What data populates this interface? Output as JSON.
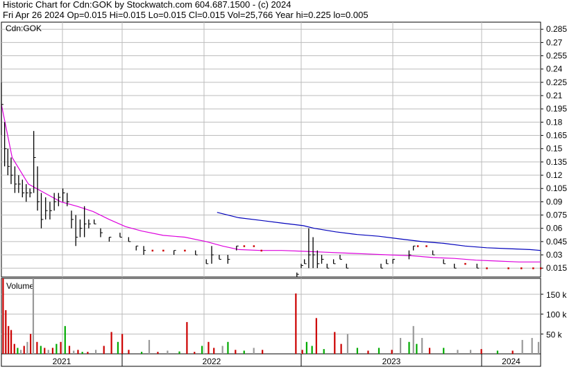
{
  "header": {
    "line1": "Historic Chart for Cdn:GOK by Stockwatch.com 604.687.1500 - (c) 2024",
    "line2": "Fri Apr 26 2024  Op=0.015  Hi=0.015  Lo=0.015  Cl=0.015  Vol=25,766  Year hi=0.225  lo=0.005"
  },
  "chart_data": [
    {
      "type": "ohlc",
      "symbol_label": "Cdn:GOK",
      "ylim": [
        0.005,
        0.293
      ],
      "y_ticks": [
        "0.285",
        "0.27",
        "0.255",
        "0.24",
        "0.225",
        "0.21",
        "0.195",
        "0.18",
        "0.165",
        "0.15",
        "0.135",
        "0.12",
        "0.105",
        "0.09",
        "0.075",
        "0.06",
        "0.045",
        "0.03",
        "0.015"
      ],
      "x_years": [
        "2021",
        "2022",
        "2023",
        "2024"
      ],
      "colors": {
        "up": "#000000",
        "flat": "#cc0000",
        "ma_short": "#dd00dd",
        "ma_long": "#0000bb",
        "grid": "#bbbbbb"
      },
      "price_bars": [
        [
          0.0,
          0.225,
          0.165,
          0.2
        ],
        [
          0.6,
          0.18,
          0.13,
          0.15
        ],
        [
          1.2,
          0.15,
          0.12,
          0.13
        ],
        [
          1.8,
          0.14,
          0.11,
          0.12
        ],
        [
          2.5,
          0.13,
          0.1,
          0.11
        ],
        [
          3.2,
          0.12,
          0.1,
          0.11
        ],
        [
          3.9,
          0.115,
          0.095,
          0.1
        ],
        [
          4.6,
          0.11,
          0.09,
          0.1
        ],
        [
          5.3,
          0.105,
          0.095,
          0.1
        ],
        [
          6.0,
          0.17,
          0.1,
          0.14
        ],
        [
          6.7,
          0.13,
          0.08,
          0.09
        ],
        [
          7.4,
          0.1,
          0.06,
          0.07
        ],
        [
          8.2,
          0.095,
          0.07,
          0.08
        ],
        [
          9.0,
          0.09,
          0.07,
          0.08
        ],
        [
          9.8,
          0.1,
          0.08,
          0.09
        ],
        [
          10.6,
          0.1,
          0.085,
          0.095
        ],
        [
          11.4,
          0.105,
          0.09,
          0.1
        ],
        [
          12.2,
          0.1,
          0.085,
          0.09
        ],
        [
          13.0,
          0.08,
          0.06,
          0.07
        ],
        [
          13.8,
          0.075,
          0.04,
          0.05
        ],
        [
          14.6,
          0.07,
          0.05,
          0.06
        ],
        [
          15.4,
          0.085,
          0.05,
          0.065
        ],
        [
          16.2,
          0.07,
          0.06,
          0.065
        ],
        [
          17.2,
          0.07,
          0.065,
          0.065
        ],
        [
          18.4,
          0.06,
          0.05,
          0.055
        ],
        [
          20.0,
          0.05,
          0.045,
          0.05
        ],
        [
          22.0,
          0.055,
          0.05,
          0.05
        ],
        [
          23.6,
          0.05,
          0.045,
          0.045
        ],
        [
          25.0,
          0.04,
          0.035,
          0.04
        ],
        [
          26.4,
          0.04,
          0.03,
          0.035
        ],
        [
          28.0,
          0.035,
          0.035,
          0.035
        ],
        [
          30.0,
          0.035,
          0.035,
          0.035
        ],
        [
          32.0,
          0.035,
          0.03,
          0.035
        ],
        [
          34.0,
          0.035,
          0.035,
          0.035
        ],
        [
          36.0,
          0.035,
          0.03,
          0.03
        ],
        [
          38.0,
          0.025,
          0.02,
          0.02
        ],
        [
          39.0,
          0.04,
          0.02,
          0.03
        ],
        [
          40.4,
          0.03,
          0.025,
          0.025
        ],
        [
          42.0,
          0.03,
          0.02,
          0.025
        ],
        [
          43.6,
          0.04,
          0.035,
          0.04
        ],
        [
          45.0,
          0.04,
          0.04,
          0.04
        ],
        [
          46.8,
          0.04,
          0.04,
          0.04
        ],
        [
          48.2,
          0.035,
          0.035,
          0.035
        ],
        [
          54.8,
          0.01,
          0.005,
          0.008
        ],
        [
          55.6,
          0.02,
          0.015,
          0.018
        ],
        [
          56.2,
          0.025,
          0.02,
          0.02
        ],
        [
          57.0,
          0.06,
          0.015,
          0.03
        ],
        [
          57.8,
          0.05,
          0.015,
          0.03
        ],
        [
          58.6,
          0.035,
          0.015,
          0.02
        ],
        [
          59.4,
          0.03,
          0.02,
          0.025
        ],
        [
          60.4,
          0.02,
          0.015,
          0.015
        ],
        [
          61.6,
          0.025,
          0.02,
          0.02
        ],
        [
          62.8,
          0.03,
          0.025,
          0.025
        ],
        [
          64.0,
          0.02,
          0.015,
          0.015
        ],
        [
          70.4,
          0.02,
          0.015,
          0.015
        ],
        [
          71.4,
          0.025,
          0.02,
          0.02
        ],
        [
          72.6,
          0.025,
          0.02,
          0.025
        ],
        [
          75.6,
          0.035,
          0.025,
          0.03
        ],
        [
          76.4,
          0.04,
          0.035,
          0.04
        ],
        [
          77.2,
          0.04,
          0.04,
          0.04
        ],
        [
          78.8,
          0.04,
          0.04,
          0.04
        ],
        [
          80.0,
          0.035,
          0.03,
          0.03
        ],
        [
          82.0,
          0.025,
          0.02,
          0.02
        ],
        [
          84.0,
          0.02,
          0.015,
          0.015
        ],
        [
          86.0,
          0.02,
          0.02,
          0.02
        ],
        [
          88.2,
          0.02,
          0.015,
          0.015
        ],
        [
          90.0,
          0.015,
          0.015,
          0.015
        ],
        [
          94.0,
          0.015,
          0.015,
          0.015
        ],
        [
          96.4,
          0.015,
          0.015,
          0.015
        ],
        [
          98.6,
          0.015,
          0.015,
          0.015
        ],
        [
          100.0,
          0.015,
          0.015,
          0.015
        ]
      ],
      "ma_short": [
        [
          0.0,
          0.2
        ],
        [
          2.0,
          0.14
        ],
        [
          5.0,
          0.11
        ],
        [
          8.0,
          0.1
        ],
        [
          11.0,
          0.09
        ],
        [
          14.0,
          0.085
        ],
        [
          17.0,
          0.079
        ],
        [
          20.0,
          0.07
        ],
        [
          23.0,
          0.062
        ],
        [
          26.0,
          0.057
        ],
        [
          30.0,
          0.052
        ],
        [
          34.0,
          0.05
        ],
        [
          38.0,
          0.045
        ],
        [
          41.0,
          0.04
        ],
        [
          44.0,
          0.036
        ],
        [
          48.0,
          0.035
        ],
        [
          52.0,
          0.035
        ],
        [
          56.0,
          0.034
        ],
        [
          60.0,
          0.033
        ],
        [
          64.0,
          0.032
        ],
        [
          68.0,
          0.031
        ],
        [
          72.0,
          0.03
        ],
        [
          76.0,
          0.029
        ],
        [
          80.0,
          0.027
        ],
        [
          84.0,
          0.026
        ],
        [
          88.0,
          0.024
        ],
        [
          92.0,
          0.023
        ],
        [
          96.0,
          0.022
        ],
        [
          100.0,
          0.022
        ]
      ],
      "ma_long": [
        [
          40.0,
          0.078
        ],
        [
          44.0,
          0.072
        ],
        [
          48.0,
          0.069
        ],
        [
          52.0,
          0.066
        ],
        [
          56.0,
          0.063
        ],
        [
          58.0,
          0.06
        ],
        [
          62.0,
          0.056
        ],
        [
          66.0,
          0.053
        ],
        [
          70.0,
          0.051
        ],
        [
          74.0,
          0.048
        ],
        [
          78.0,
          0.045
        ],
        [
          82.0,
          0.043
        ],
        [
          86.0,
          0.04
        ],
        [
          90.0,
          0.038
        ],
        [
          94.0,
          0.037
        ],
        [
          98.0,
          0.036
        ],
        [
          100.0,
          0.035
        ]
      ]
    },
    {
      "type": "bar",
      "label": "Volume",
      "ylim": [
        0,
        190
      ],
      "y_ticks": [
        "150 k",
        "100 k",
        "50 k"
      ],
      "y_tick_values": [
        150,
        100,
        50
      ],
      "colors": {
        "up": "#00aa00",
        "down": "#cc0000",
        "flat": "#999999"
      },
      "bars": [
        [
          0.3,
          190,
          "down"
        ],
        [
          0.8,
          110,
          "down"
        ],
        [
          1.3,
          70,
          "down"
        ],
        [
          1.8,
          60,
          "down"
        ],
        [
          2.4,
          25,
          "down"
        ],
        [
          3.0,
          15,
          "up"
        ],
        [
          3.6,
          10,
          "flat"
        ],
        [
          4.2,
          20,
          "down"
        ],
        [
          4.8,
          30,
          "flat"
        ],
        [
          5.4,
          50,
          "down"
        ],
        [
          5.9,
          190,
          "flat"
        ],
        [
          6.6,
          30,
          "down"
        ],
        [
          7.3,
          20,
          "up"
        ],
        [
          8.0,
          15,
          "down"
        ],
        [
          8.7,
          10,
          "flat"
        ],
        [
          9.5,
          15,
          "down"
        ],
        [
          10.2,
          25,
          "up"
        ],
        [
          11.0,
          30,
          "down"
        ],
        [
          11.8,
          70,
          "up"
        ],
        [
          12.6,
          20,
          "down"
        ],
        [
          13.4,
          8,
          "flat"
        ],
        [
          14.2,
          10,
          "down"
        ],
        [
          15.0,
          5,
          "up"
        ],
        [
          16.0,
          5,
          "down"
        ],
        [
          17.5,
          10,
          "flat"
        ],
        [
          19.0,
          20,
          "down"
        ],
        [
          20.4,
          55,
          "down"
        ],
        [
          21.6,
          30,
          "up"
        ],
        [
          22.4,
          50,
          "down"
        ],
        [
          23.6,
          10,
          "down"
        ],
        [
          26.0,
          5,
          "up"
        ],
        [
          27.4,
          35,
          "flat"
        ],
        [
          29.0,
          5,
          "down"
        ],
        [
          30.8,
          8,
          "flat"
        ],
        [
          33.0,
          6,
          "up"
        ],
        [
          34.4,
          80,
          "down"
        ],
        [
          35.8,
          5,
          "down"
        ],
        [
          37.2,
          20,
          "up"
        ],
        [
          38.4,
          30,
          "down"
        ],
        [
          39.4,
          15,
          "down"
        ],
        [
          41.0,
          20,
          "flat"
        ],
        [
          42.0,
          30,
          "up"
        ],
        [
          43.4,
          10,
          "down"
        ],
        [
          45.0,
          8,
          "up"
        ],
        [
          46.8,
          15,
          "flat"
        ],
        [
          48.4,
          10,
          "down"
        ],
        [
          54.6,
          152,
          "down"
        ],
        [
          55.8,
          10,
          "down"
        ],
        [
          56.6,
          30,
          "up"
        ],
        [
          57.6,
          20,
          "up"
        ],
        [
          58.4,
          90,
          "down"
        ],
        [
          59.8,
          12,
          "up"
        ],
        [
          61.8,
          55,
          "down"
        ],
        [
          63.0,
          25,
          "down"
        ],
        [
          64.2,
          50,
          "flat"
        ],
        [
          66.0,
          15,
          "up"
        ],
        [
          68.0,
          8,
          "down"
        ],
        [
          70.0,
          15,
          "up"
        ],
        [
          72.4,
          10,
          "down"
        ],
        [
          74.0,
          40,
          "flat"
        ],
        [
          75.6,
          30,
          "up"
        ],
        [
          76.4,
          70,
          "flat"
        ],
        [
          77.0,
          25,
          "up"
        ],
        [
          78.0,
          40,
          "flat"
        ],
        [
          79.4,
          15,
          "down"
        ],
        [
          82.0,
          15,
          "up"
        ],
        [
          84.6,
          10,
          "flat"
        ],
        [
          87.0,
          10,
          "flat"
        ],
        [
          89.0,
          12,
          "down"
        ],
        [
          92.0,
          8,
          "up"
        ],
        [
          94.8,
          8,
          "down"
        ],
        [
          96.6,
          35,
          "flat"
        ],
        [
          98.4,
          40,
          "flat"
        ],
        [
          99.6,
          30,
          "flat"
        ]
      ]
    }
  ]
}
